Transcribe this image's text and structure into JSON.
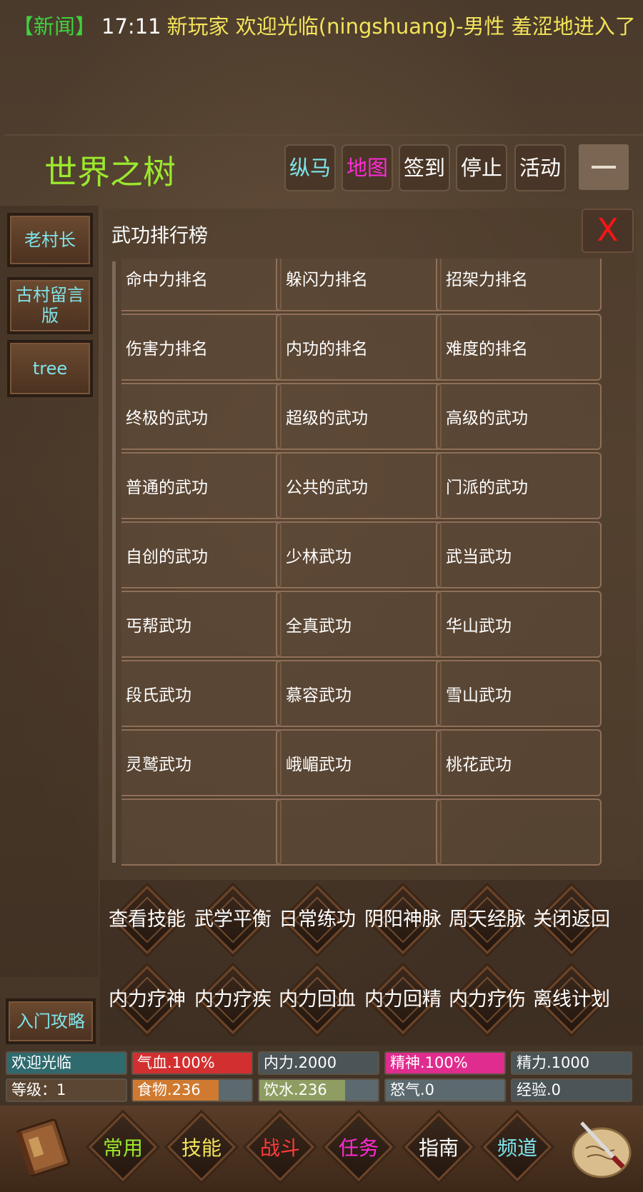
{
  "news": {
    "tag": "【新闻】",
    "time": "17:11",
    "message": "新玩家 欢迎光临(ningshuang)-男性 羞涩地进入了"
  },
  "header": {
    "title": "世界之树",
    "buttons": [
      {
        "label": "纵马",
        "color": "#7de6ee"
      },
      {
        "label": "地图",
        "color": "#ff2bd6"
      },
      {
        "label": "签到",
        "color": "#ffffff"
      },
      {
        "label": "停止",
        "color": "#ffffff"
      },
      {
        "label": "活动",
        "color": "#ffffff"
      }
    ],
    "minimize_icon": "minus-icon"
  },
  "sidebar": {
    "items": [
      "老村长",
      "古村留言版",
      "tree"
    ],
    "guide": "入门攻略"
  },
  "panel": {
    "title": "武功排行榜",
    "close_label": "X",
    "items": [
      "命中力排名",
      "躲闪力排名",
      "招架力排名",
      "伤害力排名",
      "内功的排名",
      "难度的排名",
      "终极的武功",
      "超级的武功",
      "高级的武功",
      "普通的武功",
      "公共的武功",
      "门派的武功",
      "自创的武功",
      "少林武功",
      "武当武功",
      "丐帮武功",
      "全真武功",
      "华山武功",
      "段氏武功",
      "慕容武功",
      "雪山武功",
      "灵鹫武功",
      "峨嵋武功",
      "桃花武功",
      "",
      "",
      ""
    ]
  },
  "actions": {
    "row1": [
      [
        "查看",
        "技能"
      ],
      [
        "武学",
        "平衡"
      ],
      [
        "日常",
        "练功"
      ],
      [
        "阴阳",
        "神脉"
      ],
      [
        "周天",
        "经脉"
      ],
      [
        "关闭",
        "返回"
      ]
    ],
    "row2": [
      [
        "内力",
        "疗神"
      ],
      [
        "内力",
        "疗疾"
      ],
      [
        "内力",
        "回血"
      ],
      [
        "内力",
        "回精"
      ],
      [
        "内力",
        "疗伤"
      ],
      [
        "离线",
        "计划"
      ]
    ]
  },
  "stats": {
    "row1": [
      {
        "label": "欢迎光临",
        "bg": "#2f6a6e",
        "fill": 1,
        "fillColor": "#2f6a6e"
      },
      {
        "label": "气血.100%",
        "bg": "#b92a2a",
        "fill": 1,
        "fillColor": "#d23030"
      },
      {
        "label": "内力.2000",
        "bg": "#4b5558",
        "fill": 1,
        "fillColor": "#4b5558"
      },
      {
        "label": "精神.100%",
        "bg": "#d12a86",
        "fill": 1,
        "fillColor": "#e02c8e"
      },
      {
        "label": "精力.1000",
        "bg": "#4b5558",
        "fill": 1,
        "fillColor": "#4b5558"
      }
    ],
    "row2": [
      {
        "label": "等级：1",
        "bg": "#5a4632",
        "fill": 1,
        "fillColor": "#5a4632"
      },
      {
        "label": "食物.236",
        "bg": "#5c6a70",
        "fill": 0.72,
        "fillColor": "#cf7a30"
      },
      {
        "label": "饮水.236",
        "bg": "#5c6a70",
        "fill": 0.72,
        "fillColor": "#8e9e62"
      },
      {
        "label": "怒气.0",
        "bg": "#5c6a70",
        "fill": 0,
        "fillColor": "#5c6a70"
      },
      {
        "label": "经验.0",
        "bg": "#4b5558",
        "fill": 0,
        "fillColor": "#4b5558"
      }
    ]
  },
  "footer": {
    "tabs": [
      {
        "label": "常用",
        "color": "#9be82e"
      },
      {
        "label": "技能",
        "color": "#f2e35a"
      },
      {
        "label": "战斗",
        "color": "#ff3a3a"
      },
      {
        "label": "任务",
        "color": "#ff2bd6"
      },
      {
        "label": "指南",
        "color": "#ffffff"
      },
      {
        "label": "频道",
        "color": "#7de6ee"
      }
    ],
    "left_icon": "book-icon",
    "right_icon": "scroll-dagger-icon"
  }
}
